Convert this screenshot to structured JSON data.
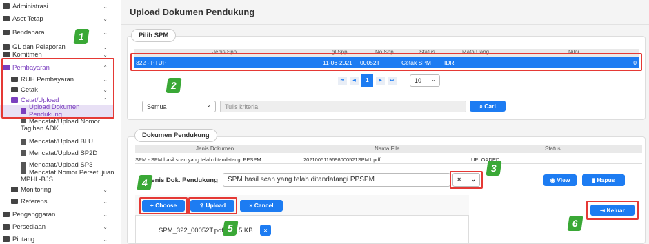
{
  "sidebar": {
    "items": [
      {
        "label": "Administrasi",
        "chev": "⌄"
      },
      {
        "label": "Aset Tetap",
        "chev": "⌄"
      },
      {
        "label": "Bendahara",
        "chev": "⌄"
      },
      {
        "label": "GL dan Pelaporan",
        "chev": "⌄"
      },
      {
        "label": "Komitmen",
        "chev": "⌄"
      },
      {
        "label": "Pembayaran",
        "chev": "⌃"
      },
      {
        "label": "RUH Pembayaran",
        "chev": "⌄"
      },
      {
        "label": "Cetak",
        "chev": "⌄"
      },
      {
        "label": "Catat/Upload",
        "chev": "⌃"
      },
      {
        "label": "Upload Dokumen Pendukung"
      },
      {
        "label": "Mencatat/Upload Nomor Tagihan ADK"
      },
      {
        "label": "Mencatat/Upload BLU"
      },
      {
        "label": "Mencatat/Upload SP2D"
      },
      {
        "label": "Mencatat/Upload SP3"
      },
      {
        "label": "Mencatat Nomor Persetujuan MPHL-BJS"
      },
      {
        "label": "Monitoring",
        "chev": "⌄"
      },
      {
        "label": "Referensi",
        "chev": "⌄"
      },
      {
        "label": "Penganggaran",
        "chev": "⌄"
      },
      {
        "label": "Persediaan",
        "chev": "⌄"
      },
      {
        "label": "Piutang",
        "chev": "⌄"
      }
    ]
  },
  "page_title": "Upload Dokumen Pendukung",
  "pilih_spm": {
    "legend": "Pilih SPM",
    "headers": [
      "Jenis Spp",
      "Tgl Spp",
      "No Spp",
      "Status",
      "Mata Uang",
      "Nilai"
    ],
    "row": [
      "322 - PTUP",
      "11-06-2021",
      "00052T",
      "Cetak SPM",
      "IDR",
      "0"
    ],
    "pagination": {
      "first": "⏮",
      "prev": "◀",
      "current": "1",
      "next": "▶",
      "last": "⏭",
      "rows": "10"
    },
    "filter": {
      "select": "Semua",
      "placeholder": "Tulis kriteria",
      "button": "Cari"
    }
  },
  "dokumen": {
    "legend": "Dokumen Pendukung",
    "headers": [
      "Jenis Dokumen",
      "Nama File",
      "Status"
    ],
    "row": [
      "SPM - SPM hasil scan yang telah ditandatangi PPSPM",
      "2021005119698000521SPM1.pdf",
      "UPLOADED"
    ],
    "jenis_label": "Jenis Dok. Pendukung",
    "jenis_value": "SPM hasil scan yang telah ditandatangi PPSPM",
    "view": "View",
    "hapus": "Hapus",
    "choose": "Choose",
    "upload": "Upload",
    "cancel": "Cancel",
    "file_name": "SPM_322_00052T.pdf",
    "file_size": "5 KB",
    "keluar": "Keluar"
  },
  "markers": [
    "1",
    "2",
    "3",
    "4",
    "5",
    "6"
  ],
  "colors": {
    "accent": "#1d7cf2",
    "highlight": "#e53935",
    "marker": "#3aa836",
    "active_menu": "#7b3fbf"
  }
}
